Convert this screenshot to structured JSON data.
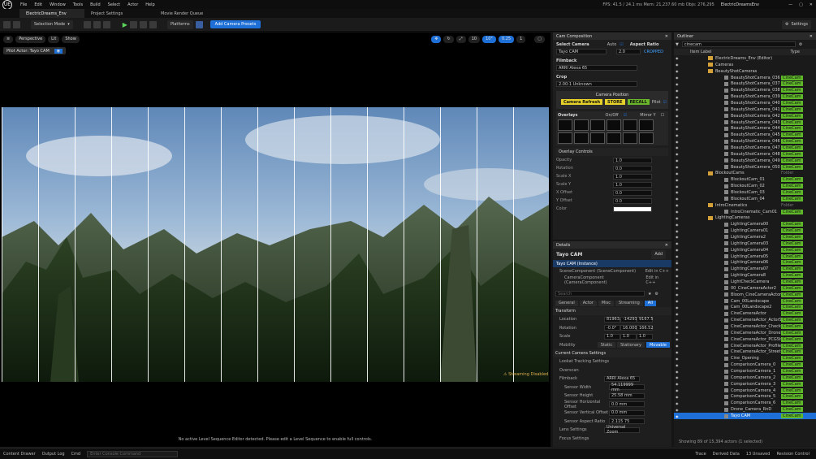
{
  "app": {
    "project_name": "ElectricDreamsEnv",
    "logo": "UE",
    "menus": [
      "File",
      "Edit",
      "Window",
      "Tools",
      "Build",
      "Select",
      "Actor",
      "Help"
    ],
    "stats": "FPS: 41.5 / 24.1 ms   Mem: 21,237.60 mb   Objs: 276,295"
  },
  "tabs": [
    {
      "label": "ElectricDreams_Env"
    },
    {
      "label": "Project Settings"
    },
    {
      "label": "Movie Render Queue"
    }
  ],
  "toolbar": {
    "selection_mode": "Selection Mode",
    "platforms": "Platforms",
    "add_camera_presets": "Add Camera Presets",
    "settings": "Settings"
  },
  "viewport": {
    "perspective": "Perspective",
    "lit": "Lit",
    "show": "Show",
    "pilot_actor": "Pilot Actor: Tayo CAM",
    "grid_snap": "10",
    "rot_snap": "10°",
    "scale_snap": "0.25",
    "cam_speed": "1",
    "streaming": "Streaming Disabled",
    "message": "No active Level Sequence Editor detected. Please edit a Level Sequence to enable full controls."
  },
  "cam_comp": {
    "title": "Cam Composition",
    "select_camera_label": "Select Camera",
    "select_camera_value": "Tayo CAM",
    "auto": "Auto",
    "aspect_ratio_label": "Aspect Ratio",
    "aspect_ratio_value": "2.0",
    "cropped": "CROPPED",
    "filmback_label": "Filmback",
    "filmback_value": "ARRI Alexa 65",
    "crop_label": "Crop",
    "crop_value": "2.00:1 Unknown",
    "camera_position": "Camera Position",
    "camera_refresh": "Camera Refresh",
    "store": "STORE",
    "recall": "RECALL",
    "pilot": "Pilot",
    "overlays": "Overlays",
    "onoff": "On/Off",
    "mirror": "Mirror Y",
    "overlay_controls": "Overlay Controls",
    "controls": [
      {
        "label": "Opacity",
        "value": "1.0"
      },
      {
        "label": "Rotation",
        "value": "0.0"
      },
      {
        "label": "Scale X",
        "value": "1.0"
      },
      {
        "label": "Scale Y",
        "value": "1.0"
      },
      {
        "label": "X Offset",
        "value": "0.0"
      },
      {
        "label": "Y Offset",
        "value": "0.0"
      }
    ],
    "color": "Color"
  },
  "details": {
    "title": "Details",
    "actor": "Tayo CAM",
    "add": "Add",
    "instance": "Tayo CAM (Instance)",
    "scene_comp": "SceneComponent (SceneComponent)",
    "cam_comp": "CameraComponent (CameraComponent)",
    "edit_cpp": "Edit in C++",
    "search": "Search",
    "subtabs": [
      "General",
      "Actor",
      "Misc",
      "Streaming",
      "All"
    ],
    "transform": "Transform",
    "location": "Location",
    "location_vals": [
      "81963.",
      "-14293",
      "9167.5"
    ],
    "rotation": "Rotation",
    "rotation_vals": [
      "-0.0°",
      "16.0000",
      "166.52"
    ],
    "scale": "Scale",
    "scale_vals": [
      "1.0",
      "1.0",
      "1.0"
    ],
    "mobility": "Mobility",
    "mobility_opts": [
      "Static",
      "Stationary",
      "Movable"
    ],
    "current_camera": "Current Camera Settings",
    "lookat": "Lookat Tracking Settings",
    "overscan": "Overscan",
    "filmback": "Filmback",
    "filmback_val": "ARRI Alexa 65",
    "sensor": [
      {
        "label": "Sensor Width",
        "value": "54.119999 mm"
      },
      {
        "label": "Sensor Height",
        "value": "25.58 mm"
      },
      {
        "label": "Sensor Horizontal Offset",
        "value": "0.0 mm"
      },
      {
        "label": "Sensor Vertical Offset",
        "value": "0.0 mm"
      },
      {
        "label": "Sensor Aspect Ratio",
        "value": "2.115 75"
      }
    ],
    "lens": "Lens Settings",
    "lens_val": "Universal Zoom",
    "focus": "Focus Settings"
  },
  "outliner": {
    "title": "Outliner",
    "search": "cinecam",
    "col_label": "Item Label",
    "col_type": "Type",
    "footer": "Showing 89 of 15,394 actors (1 selected)",
    "rows": [
      {
        "t": "ElectricDreams_Env (Editor)",
        "k": "",
        "f": 1
      },
      {
        "t": "Cameras",
        "k": "",
        "f": 1
      },
      {
        "t": "BeautyShotCameras",
        "k": "",
        "f": 1
      },
      {
        "t": "BeautyShotCamera_036",
        "k": "CineCam"
      },
      {
        "t": "BeautyShotCamera_037",
        "k": "CineCam"
      },
      {
        "t": "BeautyShotCamera_038",
        "k": "CineCam"
      },
      {
        "t": "BeautyShotCamera_039",
        "k": "CineCam"
      },
      {
        "t": "BeautyShotCamera_040",
        "k": "CineCam"
      },
      {
        "t": "BeautyShotCamera_041",
        "k": "CineCam"
      },
      {
        "t": "BeautyShotCamera_042",
        "k": "CineCam"
      },
      {
        "t": "BeautyShotCamera_043",
        "k": "CineCam"
      },
      {
        "t": "BeautyShotCamera_044",
        "k": "CineCam"
      },
      {
        "t": "BeautyShotCamera_045",
        "k": "CineCam"
      },
      {
        "t": "BeautyShotCamera_046",
        "k": "CineCam"
      },
      {
        "t": "BeautyShotCamera_047",
        "k": "CineCam"
      },
      {
        "t": "BeautyShotCamera_048",
        "k": "CineCam"
      },
      {
        "t": "BeautyShotCamera_049",
        "k": "CineCam"
      },
      {
        "t": "BeautyShotCamera_050",
        "k": "CineCam"
      },
      {
        "t": "BlockoutCams",
        "k": "Folder",
        "f": 1
      },
      {
        "t": "BlockoutCam_01",
        "k": "CineCam"
      },
      {
        "t": "BlockoutCam_02",
        "k": "CineCam"
      },
      {
        "t": "BlockoutCam_03",
        "k": "CineCam"
      },
      {
        "t": "BlockoutCam_04",
        "k": "CineCam"
      },
      {
        "t": "IntroCinematics",
        "k": "Folder",
        "f": 1
      },
      {
        "t": "IntroCinematic_Cam01",
        "k": "CineCam"
      },
      {
        "t": "LightingCameras",
        "k": "",
        "f": 1
      },
      {
        "t": "LightingCamera00",
        "k": "CineCam"
      },
      {
        "t": "LightingCamera01",
        "k": "CineCam"
      },
      {
        "t": "LightingCamera2",
        "k": "CineCam"
      },
      {
        "t": "LightingCamera03",
        "k": "CineCam"
      },
      {
        "t": "LightingCamera04",
        "k": "CineCam"
      },
      {
        "t": "LightingCamera05",
        "k": "CineCam"
      },
      {
        "t": "LightingCamera06",
        "k": "CineCam"
      },
      {
        "t": "LightingCamera07",
        "k": "CineCam"
      },
      {
        "t": "LightingCamera8",
        "k": "CineCam"
      },
      {
        "t": "LightCheckCamera",
        "k": "CineCam"
      },
      {
        "t": "00_CineCameraActor2",
        "k": "CineCam"
      },
      {
        "t": "Bloom_CineCameraActor",
        "k": "CineCam"
      },
      {
        "t": "Cam_00Landscape",
        "k": "CineCam"
      },
      {
        "t": "Cam_00Landscape2",
        "k": "CineCam"
      },
      {
        "t": "CineCameraActor",
        "k": "CineCam"
      },
      {
        "t": "CineCameraActor_ActorStart",
        "k": "CineCam"
      },
      {
        "t": "CineCameraActor_Checkpoint03",
        "k": "CineCam"
      },
      {
        "t": "CineCameraActor_DroneStart",
        "k": "CineCam"
      },
      {
        "t": "CineCameraActor_PCGStartMarl",
        "k": "CineCam"
      },
      {
        "t": "CineCameraActor_Profile",
        "k": "CineCam"
      },
      {
        "t": "CineCameraActor_StreetStartMe",
        "k": "CineCam"
      },
      {
        "t": "Cine_Opening",
        "k": "CineCam"
      },
      {
        "t": "ComparisonCamera_0",
        "k": "CineCam"
      },
      {
        "t": "ComparisonCamera_1",
        "k": "CineCam"
      },
      {
        "t": "ComparisonCamera_2",
        "k": "CineCam"
      },
      {
        "t": "ComparisonCamera_3",
        "k": "CineCam"
      },
      {
        "t": "ComparisonCamera_4",
        "k": "CineCam"
      },
      {
        "t": "ComparisonCamera_5",
        "k": "CineCam"
      },
      {
        "t": "ComparisonCamera_6",
        "k": "CineCam"
      },
      {
        "t": "Drone_Camera_RnD",
        "k": "CineCam"
      },
      {
        "t": "Tayo CAM",
        "k": "CineCam",
        "sel": 1
      }
    ]
  },
  "statusbar": {
    "content_drawer": "Content Drawer",
    "output_log": "Output Log",
    "cmd": "Cmd",
    "cmd_placeholder": "Enter Console Command",
    "trace": "Trace",
    "derived": "Derived Data",
    "unsaved": "13 Unsaved",
    "revision": "Revision Control"
  }
}
